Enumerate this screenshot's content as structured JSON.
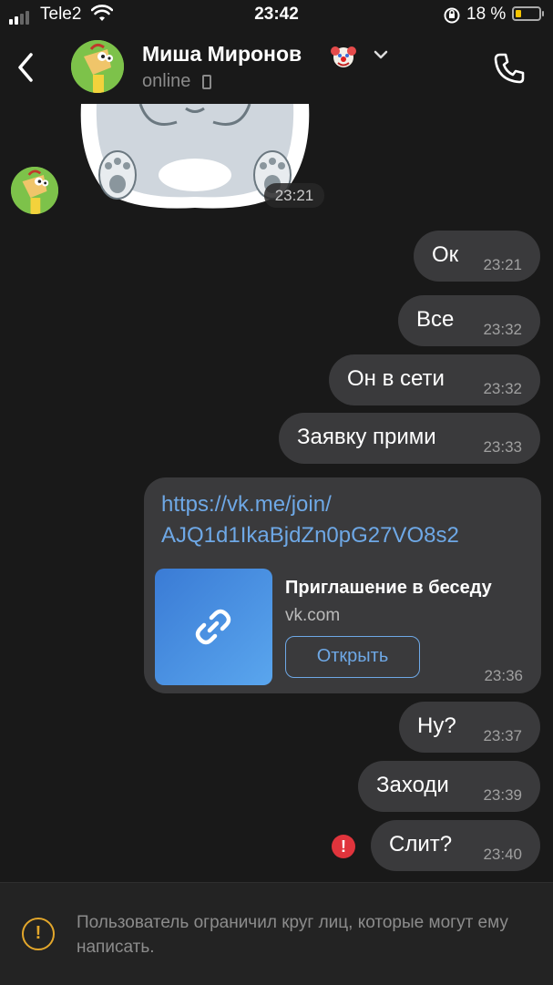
{
  "status_bar": {
    "carrier": "Tele2",
    "time": "23:42",
    "battery": "18 %",
    "battery_color": "#f5c400"
  },
  "header": {
    "contact_name": "Миша Миронов",
    "status": "online",
    "back_icon": "chevron-left-icon",
    "call_icon": "phone-icon",
    "expand_icon": "chevron-down-icon",
    "emoji_icon": "clown-icon"
  },
  "messages": [
    {
      "type": "sticker",
      "time": "23:21"
    },
    {
      "type": "text",
      "text": "Ок",
      "time": "23:21"
    },
    {
      "type": "text",
      "text": "Все",
      "time": "23:32"
    },
    {
      "type": "text",
      "text": "Он в сети",
      "time": "23:32"
    },
    {
      "type": "text",
      "text": "Заявку прими",
      "time": "23:33"
    },
    {
      "type": "link",
      "url_line1": "https://vk.me/join/",
      "url_line2": "AJQ1d1IkaBjdZn0pG27VO8s2",
      "preview_title": "Приглашение в беседу",
      "preview_domain": "vk.com",
      "open_button": "Открыть",
      "time": "23:36"
    },
    {
      "type": "text",
      "text": "Ну?",
      "time": "23:37"
    },
    {
      "type": "text",
      "text": "Заходи",
      "time": "23:39"
    },
    {
      "type": "text",
      "text": "Слит?",
      "time": "23:40",
      "error_badge": "!"
    }
  ],
  "footer": {
    "warning_icon": "!",
    "warning_text": "Пользователь ограничил круг лиц, которые могут ему написать."
  },
  "colors": {
    "background": "#191919",
    "bubble": "#3a3a3c",
    "link": "#6ea8e6",
    "warning": "#e3a72b",
    "error": "#e0343c"
  }
}
